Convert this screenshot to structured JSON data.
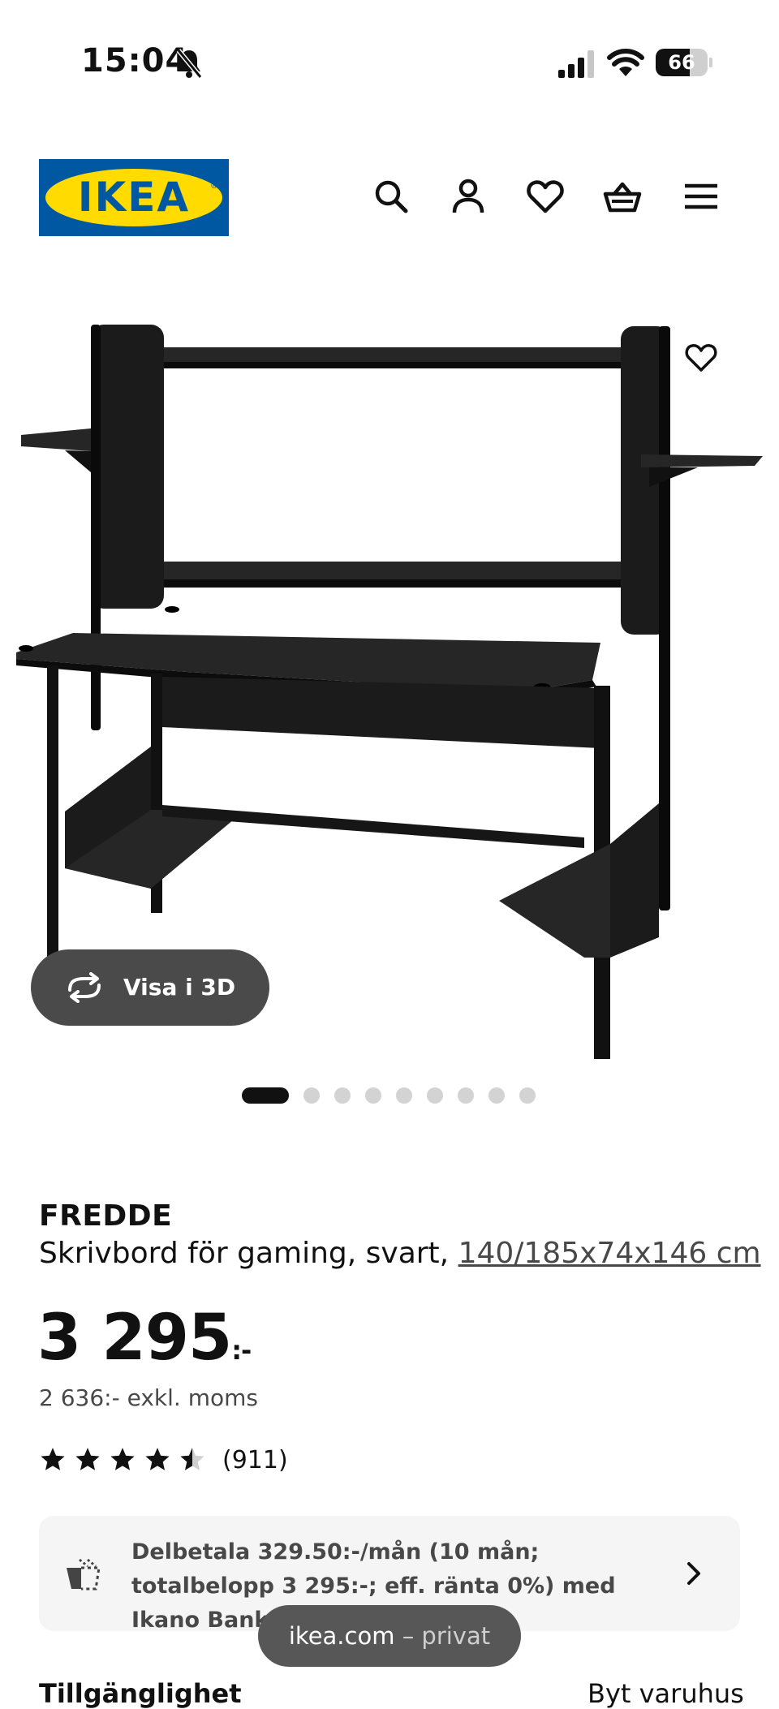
{
  "status_bar": {
    "time": "15:04",
    "battery": "66",
    "battery_level": 0.66
  },
  "header": {
    "logo_text": "IKEA",
    "icons": [
      "search-icon",
      "account-icon",
      "heart-icon",
      "basket-icon",
      "menu-icon"
    ]
  },
  "gallery": {
    "view_3d_label": "Visa i 3D",
    "slide_count": 9,
    "active_slide": 1
  },
  "product": {
    "name": "FREDDE",
    "description": "Skrivbord för gaming, svart,",
    "dimensions": "140/185x74x146 cm",
    "price": "3 295",
    "price_suffix": ":-",
    "price_ex_vat": "2 636:- exkl. moms",
    "rating": 4.5,
    "rating_count": "(911)"
  },
  "finance": {
    "text": "Delbetala 329.50:-/mån (10 mån; totalbelopp 3 295:-; eff. ränta 0%) med Ikano Bank"
  },
  "browser": {
    "domain": "ikea.com",
    "mode": "– privat"
  },
  "availability": {
    "label": "Tillgänglighet",
    "store_link": "Byt varuhus"
  },
  "colors": {
    "ikea_blue": "#0058a3",
    "ikea_yellow": "#ffdb00",
    "text": "#111111"
  }
}
